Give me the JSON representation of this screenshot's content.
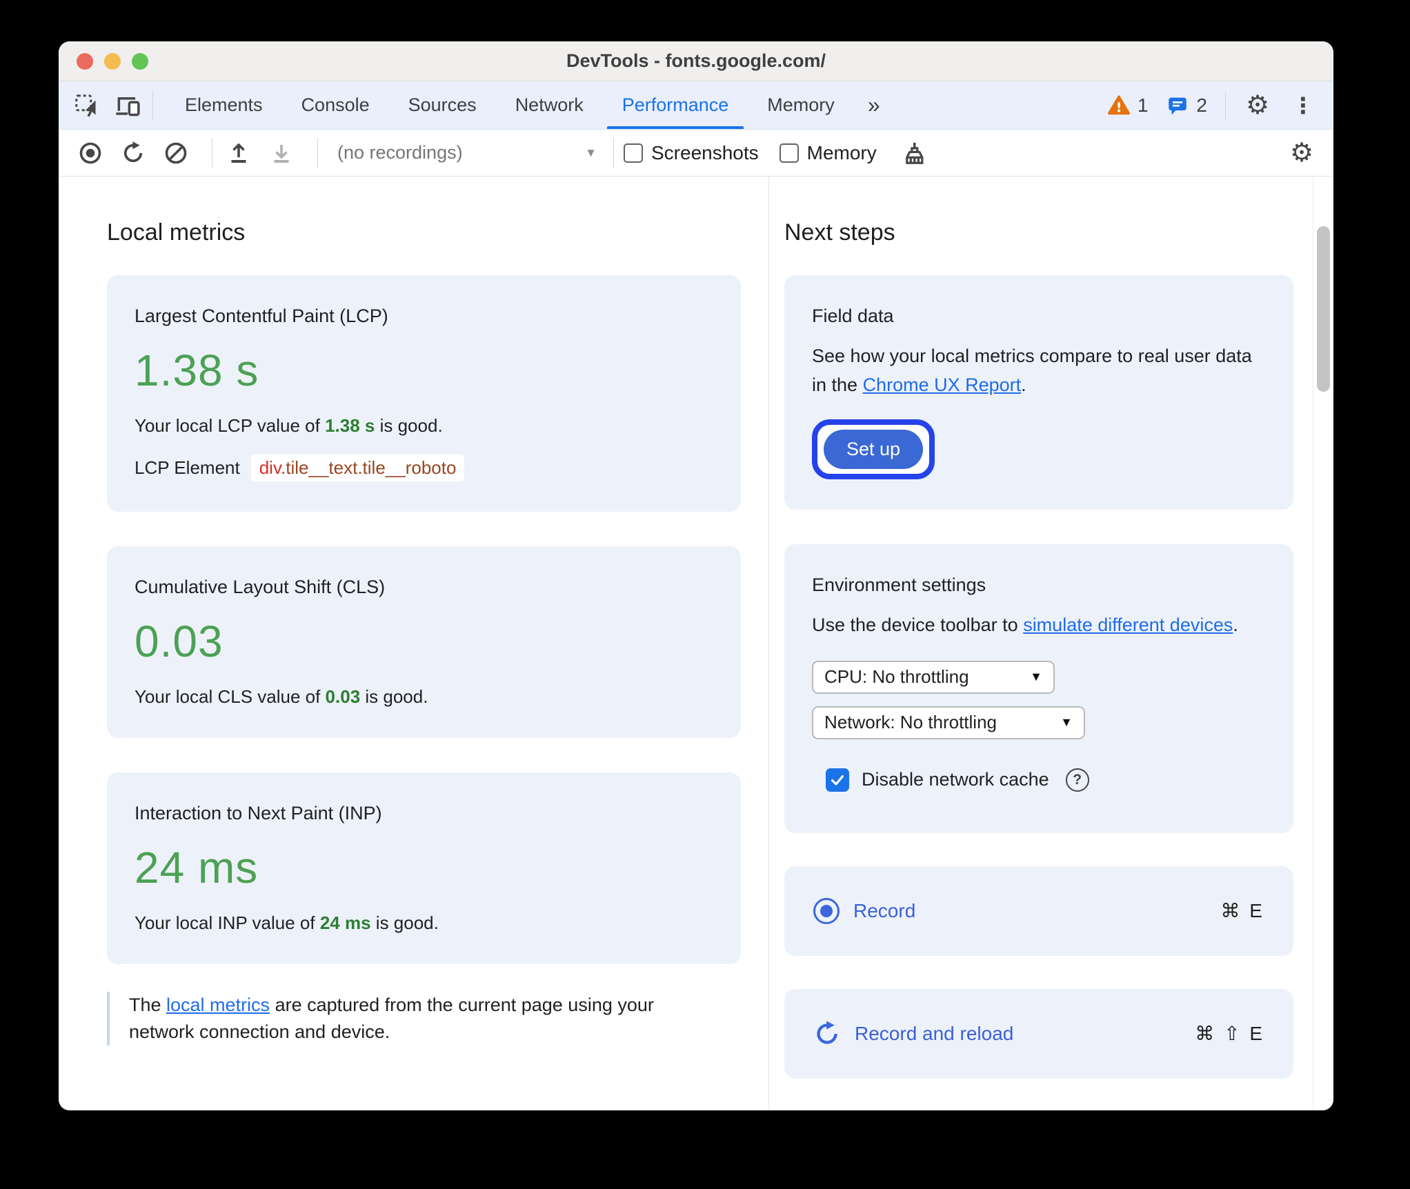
{
  "window": {
    "title": "DevTools - fonts.google.com/"
  },
  "tabs": {
    "items": [
      {
        "label": "Elements"
      },
      {
        "label": "Console"
      },
      {
        "label": "Sources"
      },
      {
        "label": "Network"
      },
      {
        "label": "Performance",
        "active": true
      },
      {
        "label": "Memory"
      }
    ],
    "more_label": "»",
    "warning_count": "1",
    "message_count": "2"
  },
  "toolbar": {
    "recordings_select": "(no recordings)",
    "dropdown_arrow": "▼",
    "screenshots_label": "Screenshots",
    "memory_label": "Memory"
  },
  "local_metrics": {
    "heading": "Local metrics",
    "lcp": {
      "title": "Largest Contentful Paint (LCP)",
      "value": "1.38 s",
      "desc_prefix": "Your local LCP value of ",
      "desc_value": "1.38 s",
      "desc_suffix": " is good.",
      "element_label": "LCP Element",
      "element_tag": "div",
      "element_classes": ".tile__text.tile__roboto"
    },
    "cls": {
      "title": "Cumulative Layout Shift (CLS)",
      "value": "0.03",
      "desc_prefix": "Your local CLS value of ",
      "desc_value": "0.03",
      "desc_suffix": " is good."
    },
    "inp": {
      "title": "Interaction to Next Paint (INP)",
      "value": "24 ms",
      "desc_prefix": "Your local INP value of ",
      "desc_value": "24 ms",
      "desc_suffix": " is good."
    },
    "footnote_prefix": "The ",
    "footnote_link": "local metrics",
    "footnote_suffix": " are captured from the current page using your network connection and device."
  },
  "next_steps": {
    "heading": "Next steps",
    "field_data": {
      "title": "Field data",
      "desc_prefix": "See how your local metrics compare to real user data in the ",
      "desc_link": "Chrome UX Report",
      "desc_suffix": ".",
      "button_label": "Set up"
    },
    "environment": {
      "title": "Environment settings",
      "desc_prefix": "Use the device toolbar to ",
      "desc_link": "simulate different devices",
      "desc_suffix": ".",
      "cpu_select": "CPU: No throttling",
      "network_select": "Network: No throttling",
      "cache_label": "Disable network cache",
      "help_glyph": "?"
    },
    "record": {
      "label": "Record",
      "shortcut": "⌘ E"
    },
    "record_reload": {
      "label": "Record and reload",
      "shortcut": "⌘ ⇧ E"
    }
  },
  "colors": {
    "metric_green": "#4ca154",
    "inline_green": "#2e7d32",
    "link_blue": "#1f6ce8",
    "active_tab_blue": "#1a73e8",
    "action_blue": "#3b5fd9",
    "focus_ring_blue": "#2543ea",
    "setup_button_blue": "#3a68d4",
    "warning_orange": "#e8710a",
    "element_tag_red": "#d93025",
    "element_class_brown": "#9a4523",
    "checkbox_blue": "#1a73e8",
    "card_background": "#edf2fa"
  }
}
